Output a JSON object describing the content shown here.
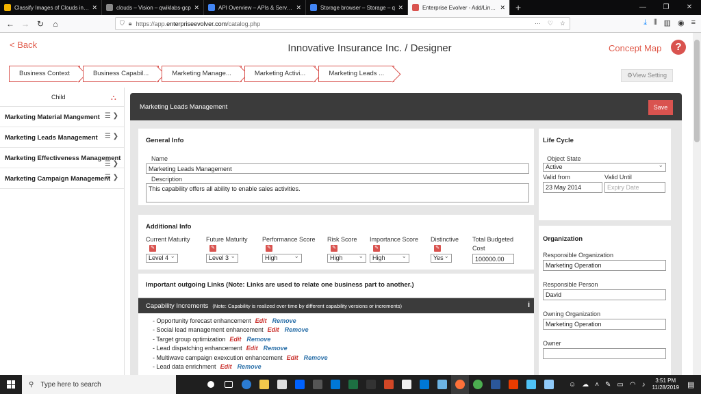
{
  "browser": {
    "tabs": [
      {
        "title": "Classify Images of Clouds in the",
        "fav_color": "#f4b400"
      },
      {
        "title": "clouds – Vision – qwiklabs-gcp",
        "fav_color": "#888888"
      },
      {
        "title": "API Overview – APIs & Services – q",
        "fav_color": "#4285f4"
      },
      {
        "title": "Storage browser – Storage – q",
        "fav_color": "#4285f4"
      },
      {
        "title": "Enterprise Evolver - Add/Link Categ",
        "fav_color": "#d9534f",
        "active": true
      }
    ],
    "url_scheme": "https://app.",
    "url_host": "enterpriseevolver.com",
    "url_path": "/catalog.php"
  },
  "header": {
    "back": "< Back",
    "title": "Innovative Insurance Inc. / Designer",
    "concept_map": "Concept Map",
    "help": "?"
  },
  "breadcrumbs": [
    "Business Context",
    "Business Capabil...",
    "Marketing Manage...",
    "Marketing Activi...",
    "Marketing Leads ..."
  ],
  "view_setting": "⚙View Setting",
  "sidebar": {
    "header": "Child",
    "items": [
      "Marketing Material Mangement",
      "Marketing Leads Management",
      "Marketing Effectiveness Management",
      "Marketing Campaign Management"
    ]
  },
  "panel": {
    "title": "Marketing Leads Management",
    "save": "Save"
  },
  "general": {
    "heading": "General Info",
    "name_label": "Name",
    "name_value": "Marketing Leads Management",
    "desc_label": "Description",
    "desc_value": "This capability offers all ability to enable sales activities."
  },
  "lifecycle": {
    "heading": "Life Cycle",
    "state_label": "Object State",
    "state_value": "Active",
    "from_label": "Valid from",
    "from_value": "23 May 2014",
    "until_label": "Valid Until",
    "until_placeholder": "Expiry Date"
  },
  "additional": {
    "heading": "Additional Info",
    "fields": [
      {
        "label": "Current Maturity",
        "value": "Level 4"
      },
      {
        "label": "Future Maturity",
        "value": "Level 3"
      },
      {
        "label": "Performance Score",
        "value": "High"
      },
      {
        "label": "Risk Score",
        "value": "High"
      },
      {
        "label": "Importance Score",
        "value": "High"
      },
      {
        "label": "Distinctive",
        "value": "Yes"
      }
    ],
    "budget_label1": "Total Budgeted",
    "budget_label2": "Cost",
    "budget_value": "100000.00"
  },
  "links_heading": "Important outgoing Links (Note: Links are used to relate one business part to another.)",
  "increments": {
    "title": "Capability Increments",
    "note": "(Note: Capability is realized over time by different capability versions or increments)",
    "edit": "Edit",
    "remove": "Remove",
    "items": [
      "- Opportunity forecast enhancement",
      "- Social lead management enhancement",
      "- Target group optimization",
      "- Lead dispatching enhancement",
      "- Multiwave campaign exexcution enhancement",
      "- Lead data enrichment"
    ]
  },
  "organization": {
    "heading": "Organization",
    "resp_org_label": "Responsible Organization",
    "resp_org_value": "Marketing Operation",
    "resp_person_label": "Responsible Person",
    "resp_person_value": "David",
    "own_org_label": "Owning Organization",
    "own_org_value": "Marketing Operation",
    "owner_label": "Owner",
    "owner_value": ""
  },
  "taskbar": {
    "search": "Type here to search",
    "time": "3:51 PM",
    "date": "11/28/2019"
  }
}
